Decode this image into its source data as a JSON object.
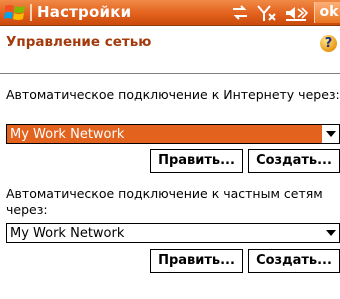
{
  "titlebar": {
    "title": "Настройки",
    "ok_label": "ok",
    "icons": [
      "windows-start-icon",
      "connectivity-icon",
      "signal-off-icon",
      "volume-icon"
    ]
  },
  "page": {
    "title": "Управление сетью",
    "help_glyph": "?"
  },
  "internet_section": {
    "description": "Автоматическое подключение к Интернету через:",
    "selected_network": "My Work Network",
    "edit_label": "Править...",
    "create_label": "Создать..."
  },
  "private_section": {
    "description": "Автоматическое подключение к частным сетям через:",
    "selected_network": "My Work Network",
    "edit_label": "Править...",
    "create_label": "Создать..."
  },
  "colors": {
    "accent": "#e2611d",
    "title_text": "#a33a0b"
  }
}
